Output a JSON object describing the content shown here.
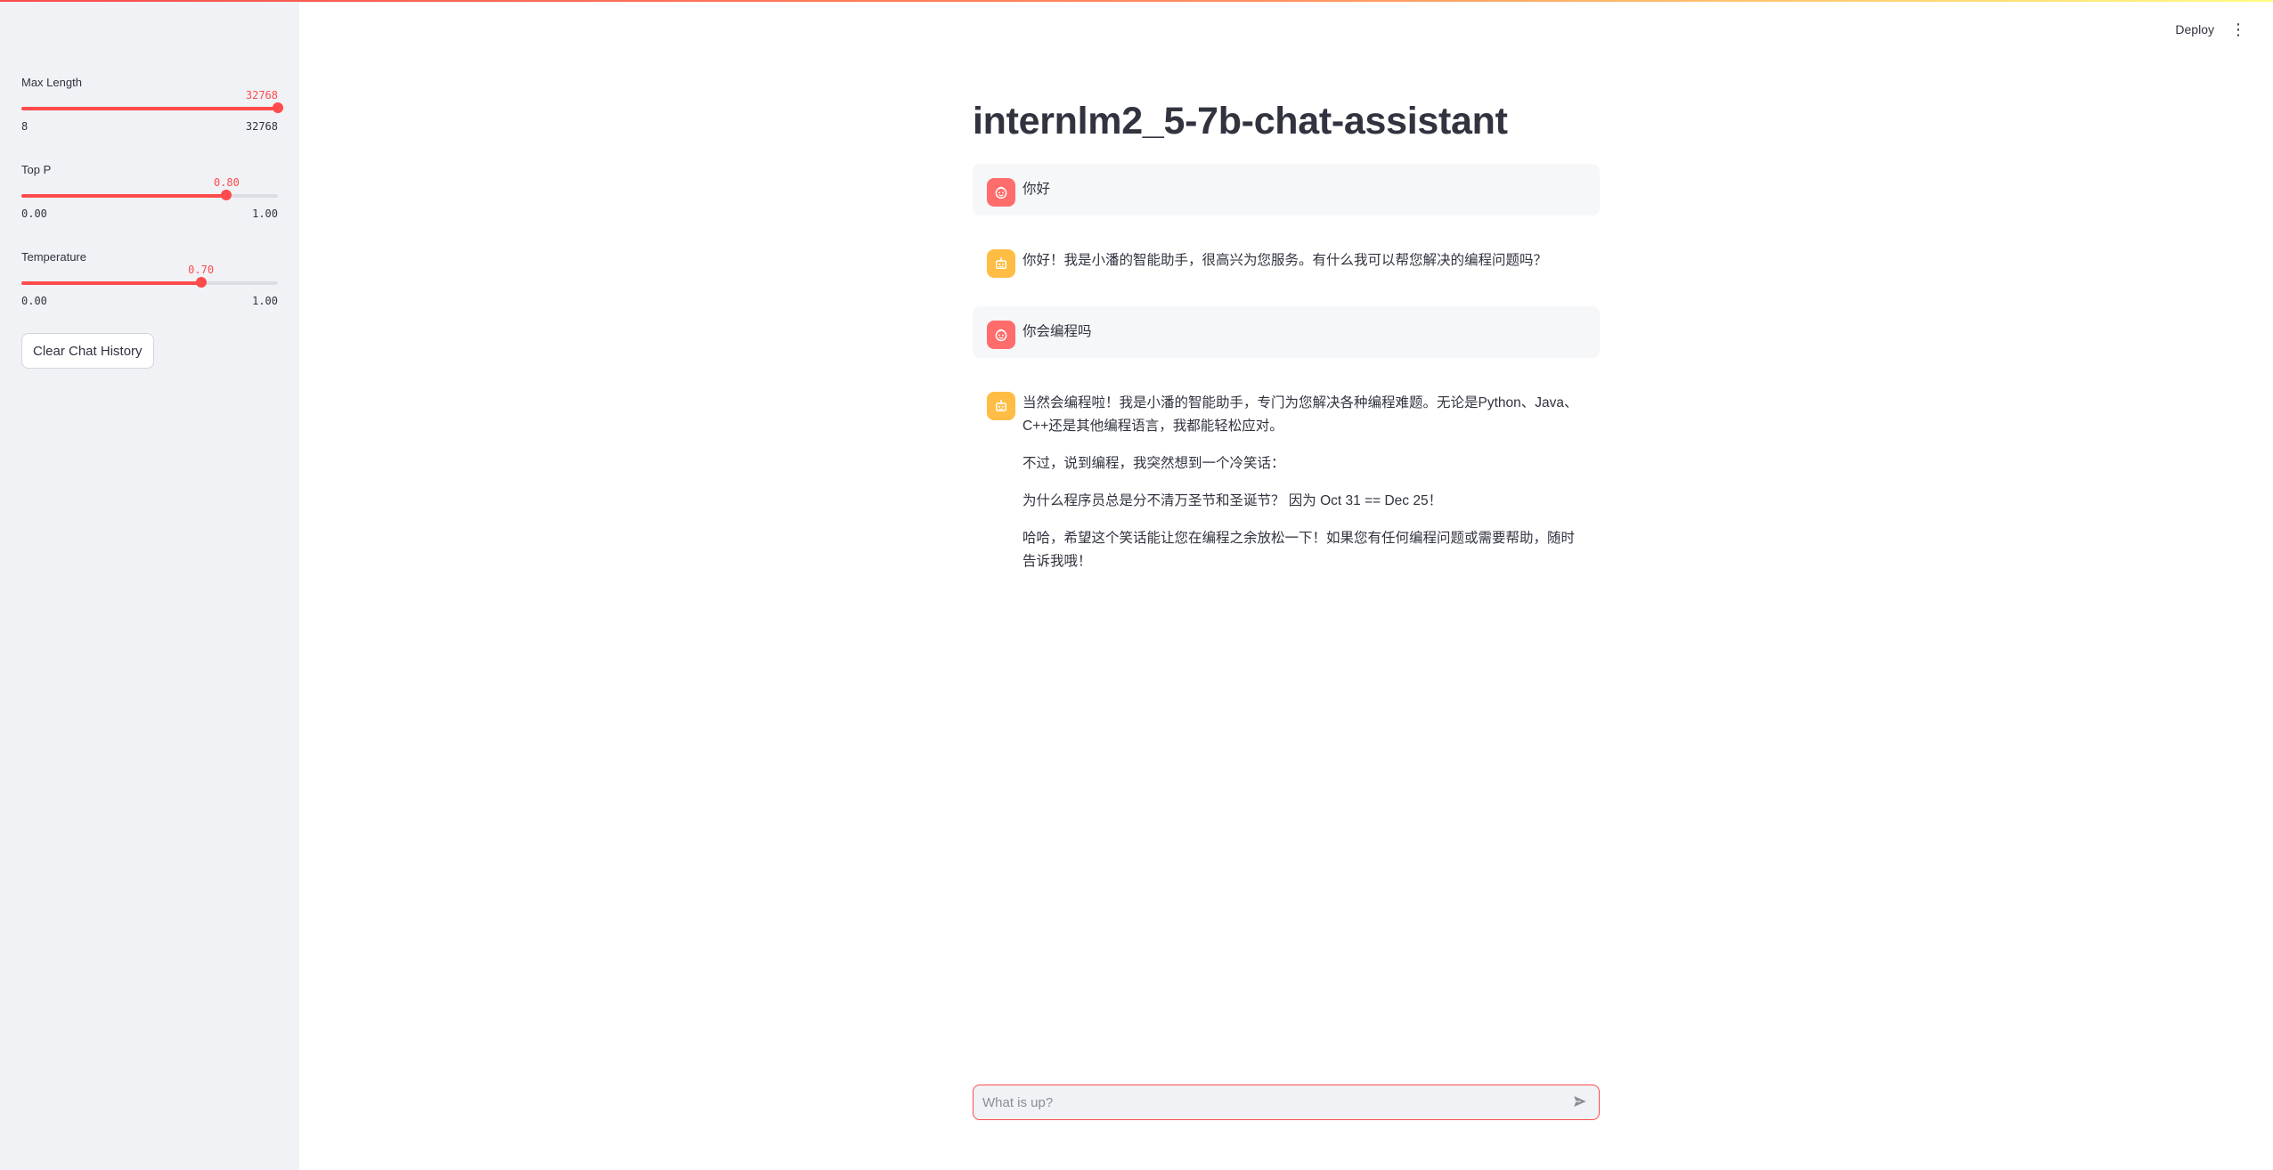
{
  "header": {
    "deploy_label": "Deploy",
    "menu_icon": "vertical-dots-icon"
  },
  "sidebar": {
    "sliders": [
      {
        "label": "Max Length",
        "value": 32768,
        "value_text": "32768",
        "min_text": "8",
        "max_text": "32768",
        "min": 8,
        "max": 32768
      },
      {
        "label": "Top P",
        "value": 0.8,
        "value_text": "0.80",
        "min_text": "0.00",
        "max_text": "1.00",
        "min": 0,
        "max": 1
      },
      {
        "label": "Temperature",
        "value": 0.7,
        "value_text": "0.70",
        "min_text": "0.00",
        "max_text": "1.00",
        "min": 0,
        "max": 1
      }
    ],
    "clear_button_label": "Clear Chat History"
  },
  "main": {
    "title": "internlm2_5-7b-chat-assistant",
    "messages": [
      {
        "role": "user",
        "icon": "user-face-icon",
        "paragraphs": [
          "你好"
        ]
      },
      {
        "role": "assistant",
        "icon": "bot-icon",
        "paragraphs": [
          "你好！我是小潘的智能助手，很高兴为您服务。有什么我可以帮您解决的编程问题吗？"
        ]
      },
      {
        "role": "user",
        "icon": "user-face-icon",
        "paragraphs": [
          "你会编程吗"
        ]
      },
      {
        "role": "assistant",
        "icon": "bot-icon",
        "paragraphs": [
          "当然会编程啦！我是小潘的智能助手，专门为您解决各种编程难题。无论是Python、Java、C++还是其他编程语言，我都能轻松应对。",
          "不过，说到编程，我突然想到一个冷笑话：",
          "为什么程序员总是分不清万圣节和圣诞节？ 因为 Oct 31 == Dec 25！",
          "哈哈，希望这个笑话能让您在编程之余放松一下！如果您有任何编程问题或需要帮助，随时告诉我哦！"
        ]
      }
    ]
  },
  "chat_input": {
    "placeholder": "What is up?",
    "value": "",
    "send_icon": "send-icon"
  },
  "colors": {
    "primary": "#ff4b4b",
    "user_avatar": "#ff6c6c",
    "assistant_avatar": "#ffbd45",
    "sidebar_bg": "#f0f2f6",
    "text": "#31333f"
  }
}
